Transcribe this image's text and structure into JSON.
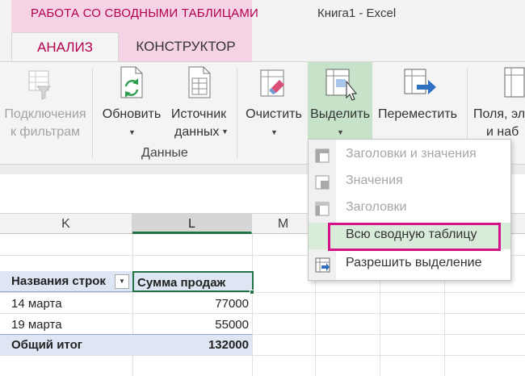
{
  "window": {
    "title": "Книга1 - Excel"
  },
  "ribbon_tabs": {
    "context_group_label": "РАБОТА СО СВОДНЫМИ ТАБЛИЦАМИ",
    "analyze": "АНАЛИЗ",
    "design": "КОНСТРУКТОР"
  },
  "ribbon": {
    "filter_connections": {
      "line1": "Подключения",
      "line2": "к фильтрам",
      "icon": "filter-connections-icon"
    },
    "refresh": {
      "line1": "Обновить",
      "icon": "refresh-icon"
    },
    "data_source": {
      "line1": "Источник",
      "line2": "данных",
      "icon": "data-source-icon"
    },
    "data_group_label": "Данные",
    "clear": {
      "line1": "Очистить",
      "icon": "clear-icon"
    },
    "select": {
      "line1": "Выделить",
      "icon": "select-icon"
    },
    "move": {
      "line1": "Переместить",
      "icon": "move-pivot-icon"
    },
    "fields": {
      "line1": "Поля, эл",
      "line2": "и наб",
      "icon": "fields-items-icon"
    }
  },
  "dropdown": {
    "items": [
      {
        "label": "Заголовки и значения",
        "enabled": false
      },
      {
        "label": "Значения",
        "enabled": false
      },
      {
        "label": "Заголовки",
        "enabled": false
      },
      {
        "label": "Всю сводную таблицу",
        "enabled": true,
        "highlighted": true
      },
      {
        "label": "Разрешить выделение",
        "enabled": true
      }
    ]
  },
  "sheet": {
    "columns": [
      "K",
      "L",
      "M"
    ],
    "selected_column": "L",
    "pivot": {
      "row_header": "Названия строк",
      "value_header": "Сумма продаж",
      "rows": [
        {
          "label": "14 марта",
          "value": "77000"
        },
        {
          "label": "19 марта",
          "value": "55000"
        }
      ],
      "total_label": "Общий итог",
      "total_value": "132000"
    }
  },
  "colors": {
    "accent": "#b4004e",
    "context_tab_bg": "#f6d3e4",
    "excel_green": "#217346",
    "hover_green": "#c6e3c9",
    "highlight_box": "#d4108a",
    "pivot_header_bg": "#dde6f2"
  }
}
